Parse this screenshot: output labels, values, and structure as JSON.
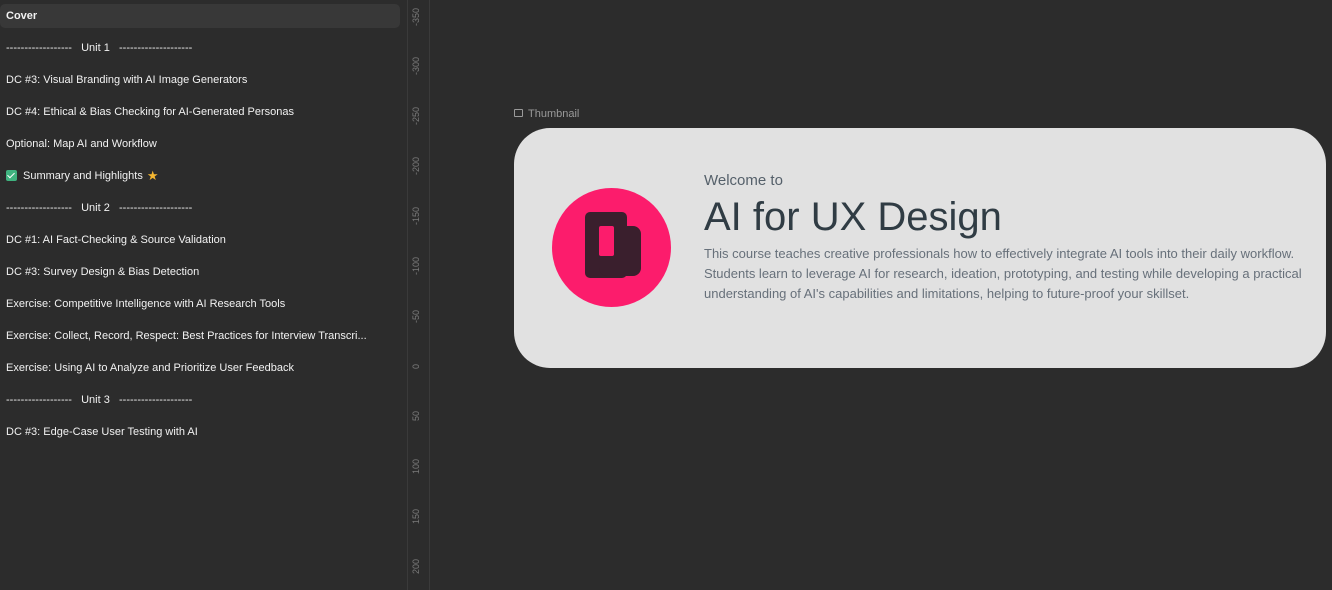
{
  "sidebar": {
    "pages": [
      {
        "label": "Cover",
        "selected": true
      },
      {
        "label": "------------------   Unit 1   --------------------"
      },
      {
        "label": "DC #3: Visual Branding with AI Image Generators"
      },
      {
        "label": "DC #4: Ethical & Bias Checking for AI-Generated Personas"
      },
      {
        "label": "Optional: Map AI and Workflow"
      },
      {
        "label": "Summary and Highlights",
        "icon_before": "check-icon",
        "icon_after": "star-icon"
      },
      {
        "label": "------------------   Unit 2   --------------------"
      },
      {
        "label": "DC #1: AI Fact-Checking & Source Validation"
      },
      {
        "label": "DC #3: Survey Design & Bias Detection"
      },
      {
        "label": "Exercise: Competitive Intelligence with AI Research Tools"
      },
      {
        "label": "Exercise: Collect, Record, Respect: Best Practices for Interview Transcri..."
      },
      {
        "label": "Exercise: Using AI to Analyze and Prioritize User Feedback"
      },
      {
        "label": "------------------   Unit 3   --------------------"
      },
      {
        "label": "DC #3: Edge-Case User Testing with AI"
      }
    ]
  },
  "ruler": {
    "ticks": [
      "-350",
      "-300",
      "-250",
      "-200",
      "-150",
      "-100",
      "-50",
      "0",
      "50",
      "100",
      "150",
      "200"
    ]
  },
  "canvas": {
    "frame_label": "Thumbnail",
    "card": {
      "welcome": "Welcome to",
      "title": "AI for UX Design",
      "description": "This course teaches creative professionals how to effectively integrate AI tools into their daily workflow. Students learn to leverage AI for research, ideation, prototyping, and testing while developing a practical understanding of AI's capabilities and limitations, helping to future-proof your skillset."
    }
  },
  "colors": {
    "background": "#2c2c2c",
    "card": "#e1e1e1",
    "logo": "#fc1c6c",
    "logo_mark": "#3a1f2d",
    "check": "#3fb37f",
    "star": "#f5b731"
  }
}
